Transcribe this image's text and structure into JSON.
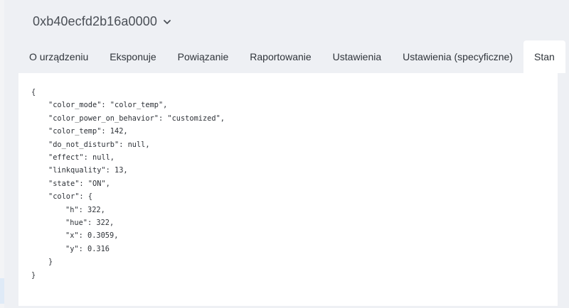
{
  "device": {
    "title": "0xb40ecfd2b16a0000",
    "chevron_icon": "chevron-down-icon"
  },
  "tabs": [
    {
      "label": "O urządzeniu",
      "active": false
    },
    {
      "label": "Eksponuje",
      "active": false
    },
    {
      "label": "Powiązanie",
      "active": false
    },
    {
      "label": "Raportowanie",
      "active": false
    },
    {
      "label": "Ustawienia",
      "active": false
    },
    {
      "label": "Ustawienia (specyficzne)",
      "active": false
    },
    {
      "label": "Stan",
      "active": true
    }
  ],
  "state_json": {
    "lines": [
      "{",
      "\"color_mode\": \"color_temp\",",
      "\"color_power_on_behavior\": \"customized\",",
      "\"color_temp\": 142,",
      "\"do_not_disturb\": null,",
      "\"effect\": null,",
      "\"linkquality\": 13,",
      "\"state\": \"ON\",",
      "\"color\": {",
      "\"h\": 322,",
      "\"hue\": 322,",
      "\"x\": 0.3059,",
      "\"y\": 0.316",
      "}",
      "}"
    ]
  },
  "colors": {
    "page_background": "#eef0f4",
    "card_background": "#ffffff",
    "text": "#2e3238"
  }
}
